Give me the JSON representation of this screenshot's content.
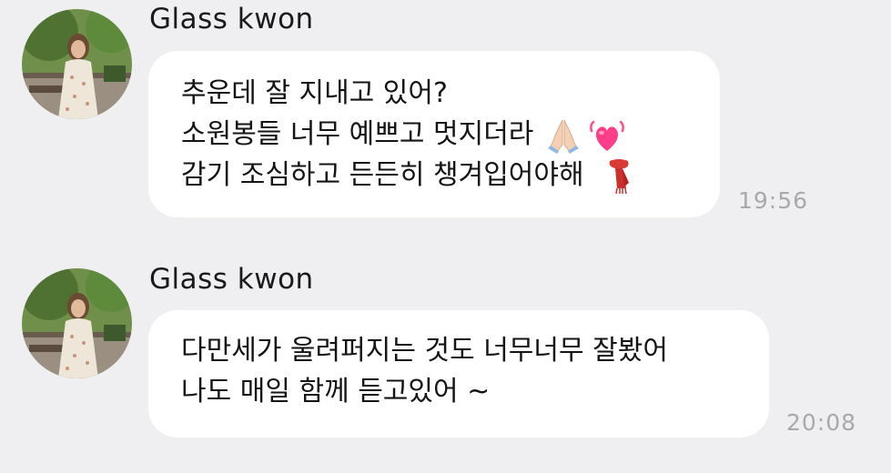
{
  "messages": [
    {
      "sender": "Glass kwon",
      "lines": [
        "추운데 잘 지내고 있어?",
        "소원봉들 너무 예쁘고 멋지더라",
        "감기 조심하고 든든히 챙겨입어야해"
      ],
      "line_emojis": [
        [],
        [
          "folded-hands-emoji",
          "beating-heart-emoji"
        ],
        [
          "scarf-emoji"
        ]
      ],
      "time": "19:56"
    },
    {
      "sender": "Glass kwon",
      "lines": [
        "다만세가 울려퍼지는 것도 너무너무 잘봤어",
        "나도 매일 함께 듣고있어 ~"
      ],
      "time": "20:08"
    }
  ],
  "colors": {
    "background": "#efeff1",
    "bubble": "#ffffff",
    "timestamp": "#a9a9ad"
  }
}
